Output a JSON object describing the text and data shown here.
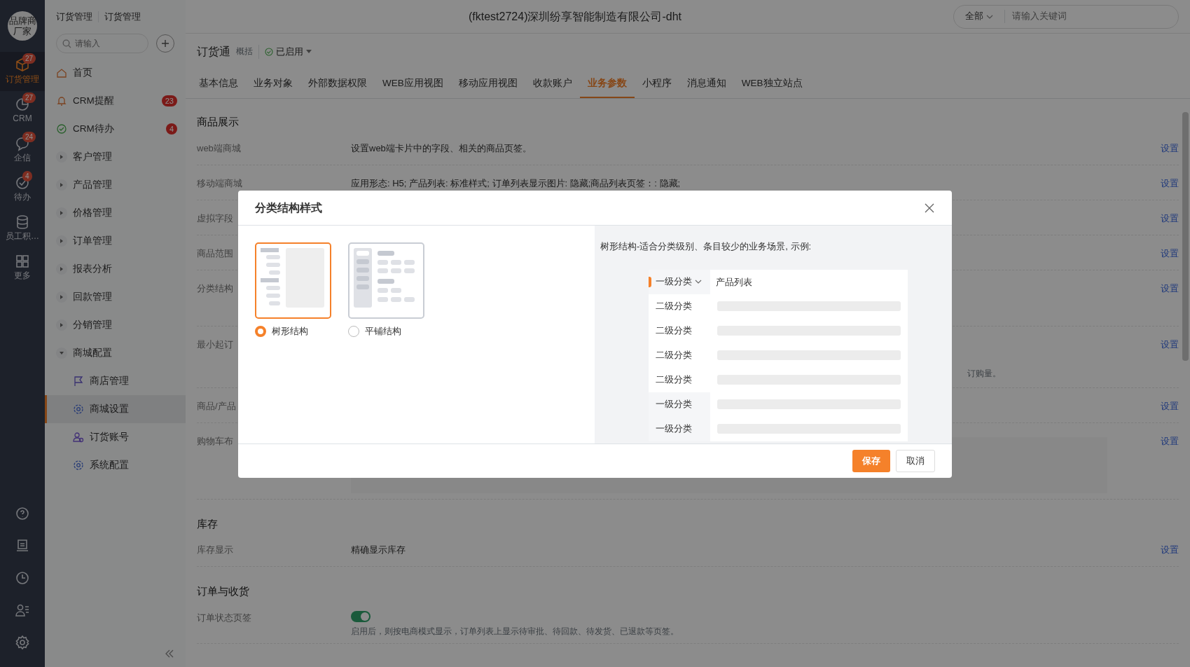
{
  "rail": {
    "logo": "品牌商厂家",
    "items": [
      {
        "label": "订货管理",
        "badge": "27",
        "selected": true
      },
      {
        "label": "CRM",
        "badge": "27",
        "selected": false
      },
      {
        "label": "企信",
        "badge": "24",
        "selected": false
      },
      {
        "label": "待办",
        "badge": "4",
        "selected": false
      },
      {
        "label": "员工积…",
        "selected": false
      },
      {
        "label": "更多",
        "selected": false
      }
    ]
  },
  "topbar": {
    "breadcrumbs": [
      "订货管理",
      "订货管理"
    ],
    "title": "(fktest2724)深圳纷享智能制造有限公司-dht",
    "search": {
      "scope": "全部",
      "placeholder": "请输入关键词"
    }
  },
  "sidebar": {
    "search": {
      "placeholder": "请输入"
    },
    "items": [
      {
        "label": "首页",
        "kind": "link",
        "selected": false
      },
      {
        "label": "CRM提醒",
        "kind": "link",
        "badge": "23",
        "selected": false
      },
      {
        "label": "CRM待办",
        "kind": "link",
        "badge": "4",
        "selected": false
      },
      {
        "label": "客户管理",
        "kind": "group",
        "expanded": false
      },
      {
        "label": "产品管理",
        "kind": "group",
        "expanded": false
      },
      {
        "label": "价格管理",
        "kind": "group",
        "expanded": false
      },
      {
        "label": "订单管理",
        "kind": "group",
        "expanded": false
      },
      {
        "label": "报表分析",
        "kind": "group",
        "expanded": false
      },
      {
        "label": "回款管理",
        "kind": "group",
        "expanded": false
      },
      {
        "label": "分销管理",
        "kind": "group",
        "expanded": false
      },
      {
        "label": "商城配置",
        "kind": "group",
        "expanded": true,
        "children": [
          {
            "label": "商店管理",
            "selected": false
          },
          {
            "label": "商城设置",
            "selected": true
          },
          {
            "label": "订货账号",
            "selected": false
          },
          {
            "label": "系统配置",
            "selected": false
          }
        ]
      }
    ]
  },
  "app_header": {
    "title": "订货通",
    "subtitle": "概括",
    "status": "已启用"
  },
  "tabs": [
    {
      "label": "基本信息",
      "selected": false
    },
    {
      "label": "业务对象",
      "selected": false
    },
    {
      "label": "外部数据权限",
      "selected": false
    },
    {
      "label": "WEB应用视图",
      "selected": false
    },
    {
      "label": "移动应用视图",
      "selected": false
    },
    {
      "label": "收款账户",
      "selected": false
    },
    {
      "label": "业务参数",
      "selected": true
    },
    {
      "label": "小程序",
      "selected": false
    },
    {
      "label": "消息通知",
      "selected": false
    },
    {
      "label": "WEB独立站点",
      "selected": false
    }
  ],
  "sections": [
    {
      "title": "商品展示",
      "rows": [
        {
          "kind": "text",
          "label": "web端商城",
          "value": "设置web端卡片中的字段、相关的商品页签。",
          "action": "设置"
        },
        {
          "kind": "text",
          "label": "移动端商城",
          "value": "应用形态: H5; 产品列表: 标准样式; 订单列表显示图片: 隐藏;商品列表页签：: 隐藏;",
          "action": "设置"
        },
        {
          "kind": "text",
          "label": "虚拟字段",
          "action": "设置"
        },
        {
          "kind": "text",
          "label": "商品范围",
          "action": "设置"
        },
        {
          "kind": "text",
          "label": "分类结构",
          "action": "设置"
        },
        {
          "kind": "text",
          "label": "最小起订",
          "note": "订购量。",
          "action": "设置"
        },
        {
          "kind": "text",
          "label": "商品/产品",
          "action": "设置"
        },
        {
          "kind": "panel",
          "label": "购物车布",
          "action": "设置"
        }
      ]
    },
    {
      "title": "库存",
      "rows": [
        {
          "kind": "text",
          "label": "库存显示",
          "value": "精确显示库存",
          "action": "设置"
        }
      ]
    },
    {
      "title": "订单与收货",
      "rows": [
        {
          "kind": "toggle",
          "label": "订单状态页签",
          "on": true,
          "note": "启用后，则按电商模式显示，订单列表上显示待审批、待回款、待发货、已退款等页签。"
        }
      ]
    }
  ],
  "dialog": {
    "title": "分类结构样式",
    "options": [
      {
        "label": "树形结构",
        "selected": true
      },
      {
        "label": "平铺结构",
        "selected": false
      }
    ],
    "description": "树形结构-适合分类级别、条目较少的业务场景, 示例:",
    "example": {
      "list_title": "产品列表",
      "categories": [
        {
          "label": "一级分类",
          "selected": true,
          "expanded": true,
          "children": [
            {
              "label": "二级分类"
            },
            {
              "label": "二级分类"
            },
            {
              "label": "二级分类"
            },
            {
              "label": "二级分类"
            }
          ]
        },
        {
          "label": "一级分类",
          "selected": false,
          "expanded": false
        },
        {
          "label": "一级分类",
          "selected": false,
          "expanded": false
        }
      ]
    },
    "buttons": [
      {
        "label": "保存",
        "kind": "primary"
      },
      {
        "label": "取消",
        "kind": "default"
      }
    ]
  }
}
